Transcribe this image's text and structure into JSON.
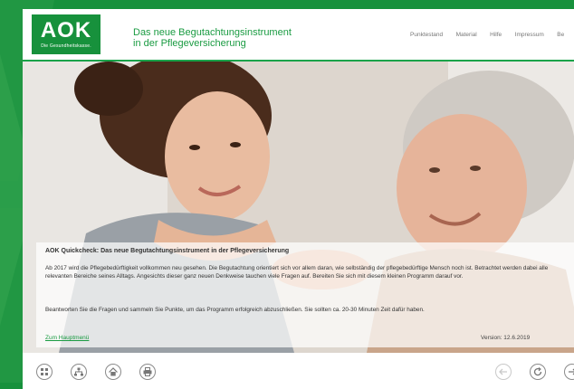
{
  "logo": {
    "mark": "AOK",
    "subtitle": "Die Gesundheitskasse."
  },
  "app_title": {
    "line1": "Das neue Begutachtungsinstrument",
    "line2": "in der Pflegeversicherung"
  },
  "topnav": {
    "items": [
      "Punktestand",
      "Material",
      "Hilfe",
      "Impressum",
      "Be"
    ]
  },
  "overlay": {
    "title": "AOK Quickcheck: Das neue Begutachtungsinstrument in der Pflegeversicherung",
    "paragraph1": "Ab 2017 wird die Pflegebedürftigkeit vollkommen neu gesehen. Die Begutachtung orientiert sich vor allem daran, wie selbständig der pflegebedürftige Mensch noch ist. Betrachtet werden dabei alle relevanten Bereiche seines Alltags. Angesichts dieser ganz neuen Denkweise tauchen viele Fragen auf. Bereiten Sie sich mit diesem kleinen Programm darauf vor.",
    "paragraph2": "Beantworten Sie die Fragen und sammeln Sie Punkte, um das Programm erfolgreich abzuschließen. Sie sollten ca. 20-30 Minuten Zeit dafür haben.",
    "link": "Zum Hauptmenü",
    "version": "Version: 12.6.2019"
  },
  "bottombar": {
    "left_icons": [
      "grid-icon",
      "sitemap-icon",
      "home-icon",
      "print-icon"
    ],
    "right_icons": [
      "back-arrow-icon",
      "reload-icon",
      "forward-arrow-icon"
    ]
  },
  "colors": {
    "brand_green": "#17913c",
    "title_green": "#1a9b42",
    "header_rule": "#1aa34a"
  }
}
